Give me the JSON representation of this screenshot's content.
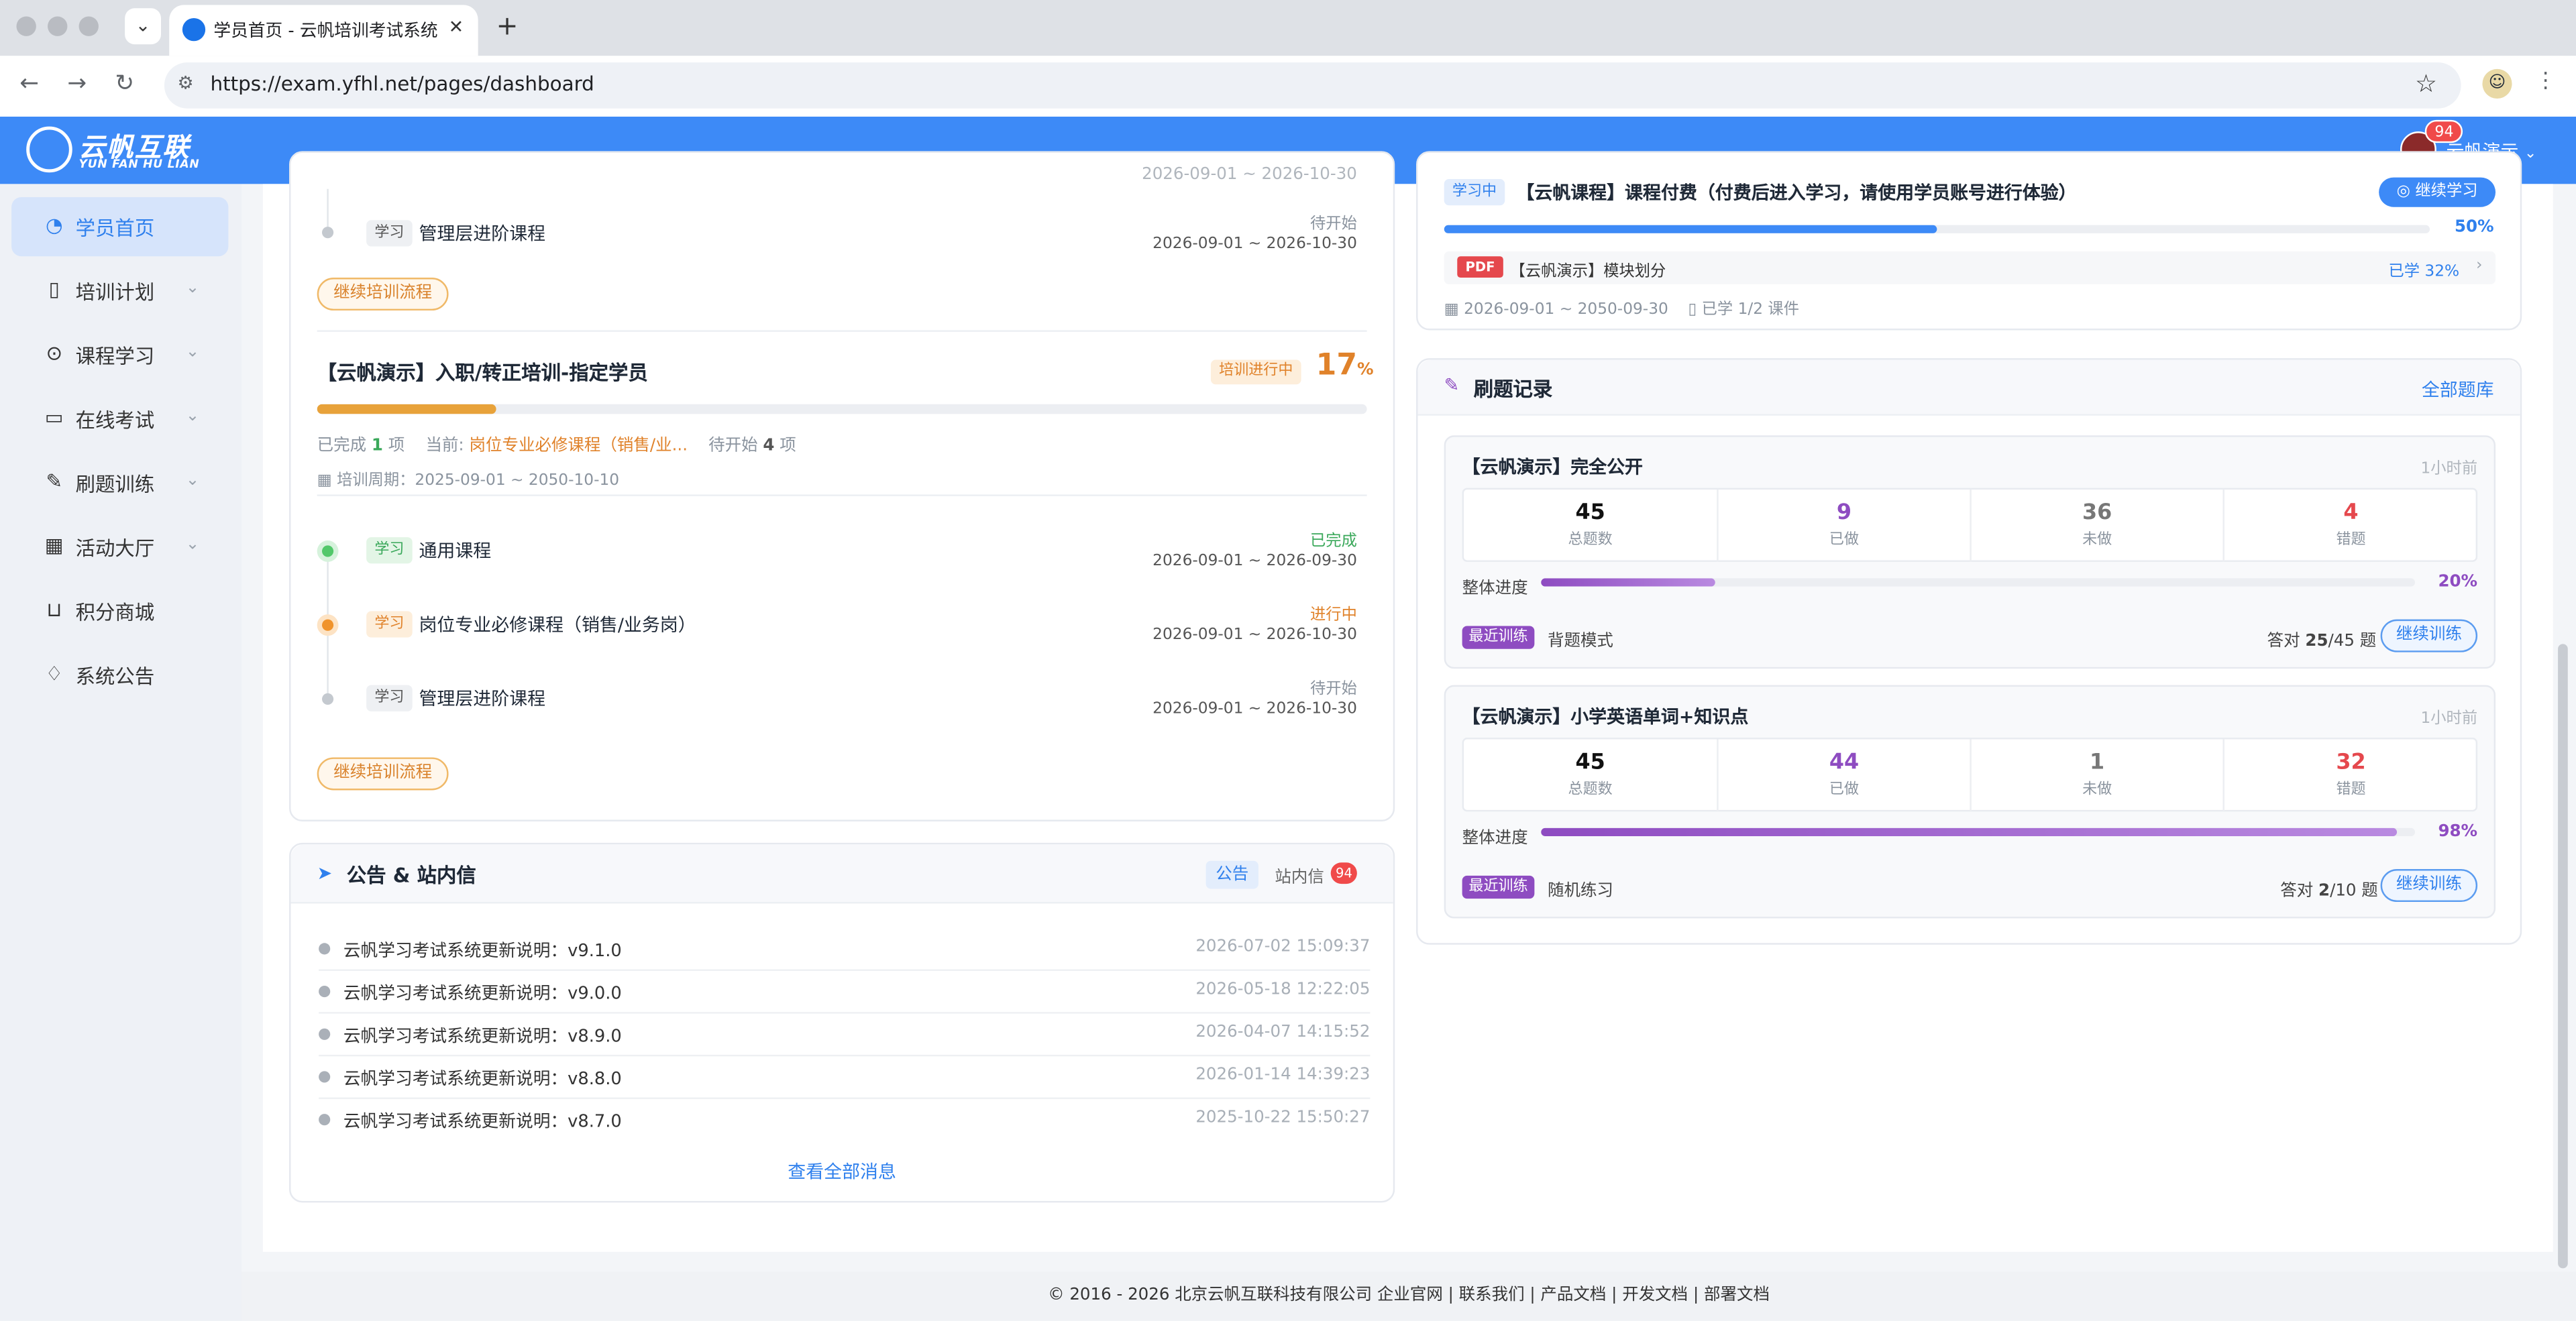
{
  "browser": {
    "tab_title": "学员首页 - 云帆培训考试系统",
    "url": "https://exam.yfhl.net/pages/dashboard"
  },
  "header": {
    "logo_cn": "云帆互联",
    "logo_en": "YUN FAN HU LIAN",
    "badge": "94",
    "user": "云帆演示"
  },
  "sidebar": {
    "items": [
      {
        "label": "学员首页",
        "icon": "dashboard-icon"
      },
      {
        "label": "培训计划",
        "icon": "book-icon"
      },
      {
        "label": "课程学习",
        "icon": "play-icon"
      },
      {
        "label": "在线考试",
        "icon": "exam-icon"
      },
      {
        "label": "刷题训练",
        "icon": "pen-icon"
      },
      {
        "label": "活动大厅",
        "icon": "calendar-icon"
      },
      {
        "label": "积分商城",
        "icon": "cart-icon"
      },
      {
        "label": "系统公告",
        "icon": "bell-icon"
      }
    ]
  },
  "training": {
    "top": {
      "cut_date": "2026-09-01 ~ 2026-10-30",
      "item_tag": "学习",
      "item_name": "管理层进阶课程",
      "item_status": "待开始",
      "item_date": "2026-09-01 ~ 2026-10-30",
      "continue": "继续培训流程"
    },
    "plan": {
      "title": "【云帆演示】入职/转正培训-指定学员",
      "status": "培训进行中",
      "percent": "17",
      "percent_unit": "%",
      "progress": 17,
      "done_label": "已完成",
      "done_count": "1",
      "done_unit": "项",
      "current_label": "当前:",
      "current_value": "岗位专业必修课程（销售/业...",
      "pending_label": "待开始",
      "pending_count": "4",
      "pending_unit": "项",
      "period": "培训周期：2025-09-01 ~ 2050-10-10",
      "steps": [
        {
          "tag": "学习",
          "name": "通用课程",
          "status": "已完成",
          "date": "2026-09-01 ~ 2026-09-30"
        },
        {
          "tag": "学习",
          "name": "岗位专业必修课程（销售/业务岗）",
          "status": "进行中",
          "date": "2026-09-01 ~ 2026-10-30"
        },
        {
          "tag": "学习",
          "name": "管理层进阶课程",
          "status": "待开始",
          "date": "2026-09-01 ~ 2026-10-30"
        }
      ],
      "continue": "继续培训流程"
    }
  },
  "announce": {
    "title": "公告 & 站内信",
    "tab_notice": "公告",
    "tab_mail": "站内信",
    "mail_badge": "94",
    "items": [
      {
        "text": "云帆学习考试系统更新说明：v9.1.0",
        "time": "2026-07-02 15:09:37"
      },
      {
        "text": "云帆学习考试系统更新说明：v9.0.0",
        "time": "2026-05-18 12:22:05"
      },
      {
        "text": "云帆学习考试系统更新说明：v8.9.0",
        "time": "2026-04-07 14:15:52"
      },
      {
        "text": "云帆学习考试系统更新说明：v8.8.0",
        "time": "2026-01-14 14:39:23"
      },
      {
        "text": "云帆学习考试系统更新说明：v8.7.0",
        "time": "2025-10-22 15:50:27"
      }
    ],
    "view_all": "查看全部消息"
  },
  "course": {
    "status": "学习中",
    "title": "【云帆课程】课程付费（付费后进入学习，请使用学员账号进行体验）",
    "continue": "继续学习",
    "percent": "50%",
    "progress": 50,
    "file_type": "PDF",
    "file_name": "【云帆演示】模块划分",
    "file_progress": "已学 32%",
    "date": "2026-09-01 ~ 2050-09-30",
    "lessons": "已学 1/2 课件"
  },
  "practice": {
    "title": "刷题记录",
    "all": "全部题库",
    "labels": {
      "total": "总题数",
      "done": "已做",
      "undone": "未做",
      "wrong": "错题",
      "overall": "整体进度",
      "recent": "最近训练",
      "resume": "继续训练"
    },
    "banks": [
      {
        "name": "【云帆演示】完全公开",
        "time": "1小时前",
        "total": "45",
        "done": "9",
        "undone": "36",
        "wrong": "4",
        "percent": "20%",
        "progress": 20,
        "mode": "背题模式",
        "ans_prefix": "答对",
        "ans_correct": "25",
        "ans_total": "/45",
        "ans_suffix": "题"
      },
      {
        "name": "【云帆演示】小学英语单词+知识点",
        "time": "1小时前",
        "total": "45",
        "done": "44",
        "undone": "1",
        "wrong": "32",
        "percent": "98%",
        "progress": 98,
        "mode": "随机练习",
        "ans_prefix": "答对",
        "ans_correct": "2",
        "ans_total": "/10",
        "ans_suffix": "题"
      }
    ]
  },
  "footer": "© 2016 - 2026 北京云帆互联科技有限公司 企业官网 | 联系我们 | 产品文档 | 开发文档 | 部署文档",
  "colors": {
    "primary": "#3d8af7",
    "orange": "#e0822a",
    "purple": "#8e4cc1",
    "green": "#3aa85a",
    "red": "#e5484d"
  }
}
